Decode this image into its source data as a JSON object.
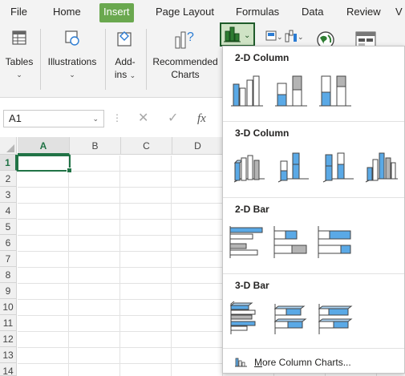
{
  "menu": {
    "tabs": [
      {
        "label": "File"
      },
      {
        "label": "Home"
      },
      {
        "label": "Insert",
        "active": true
      },
      {
        "label": "Page Layout"
      },
      {
        "label": "Formulas"
      },
      {
        "label": "Data"
      },
      {
        "label": "Review"
      },
      {
        "label": "V"
      }
    ]
  },
  "ribbon": {
    "tables": {
      "label": "Tables"
    },
    "illustrations": {
      "label": "Illustrations"
    },
    "addins": {
      "label_line1": "Add-",
      "label_line2": "ins"
    },
    "recommended": {
      "label_line1": "Recommended",
      "label_line2": "Charts"
    }
  },
  "formula_bar": {
    "name_box": "A1",
    "cancel": "✕",
    "enter": "✓",
    "fx": "fx"
  },
  "grid": {
    "columns": [
      "A",
      "B",
      "C",
      "D"
    ],
    "rows": [
      "1",
      "2",
      "3",
      "4",
      "5",
      "6",
      "7",
      "8",
      "9",
      "10",
      "11",
      "12",
      "13",
      "14"
    ],
    "active_cell": "A1"
  },
  "dropdown": {
    "sections": [
      {
        "title": "2-D Column"
      },
      {
        "title": "3-D Column"
      },
      {
        "title": "2-D Bar"
      },
      {
        "title": "3-D Bar"
      }
    ],
    "more": {
      "label": "More Column Charts...",
      "accel": "M",
      "rest": "ore Column Charts..."
    }
  },
  "colors": {
    "accent": "#217346",
    "insert_tab": "#6aa84f",
    "chart_blue": "#5aa9e6",
    "chart_gray": "#b4b4b4"
  }
}
